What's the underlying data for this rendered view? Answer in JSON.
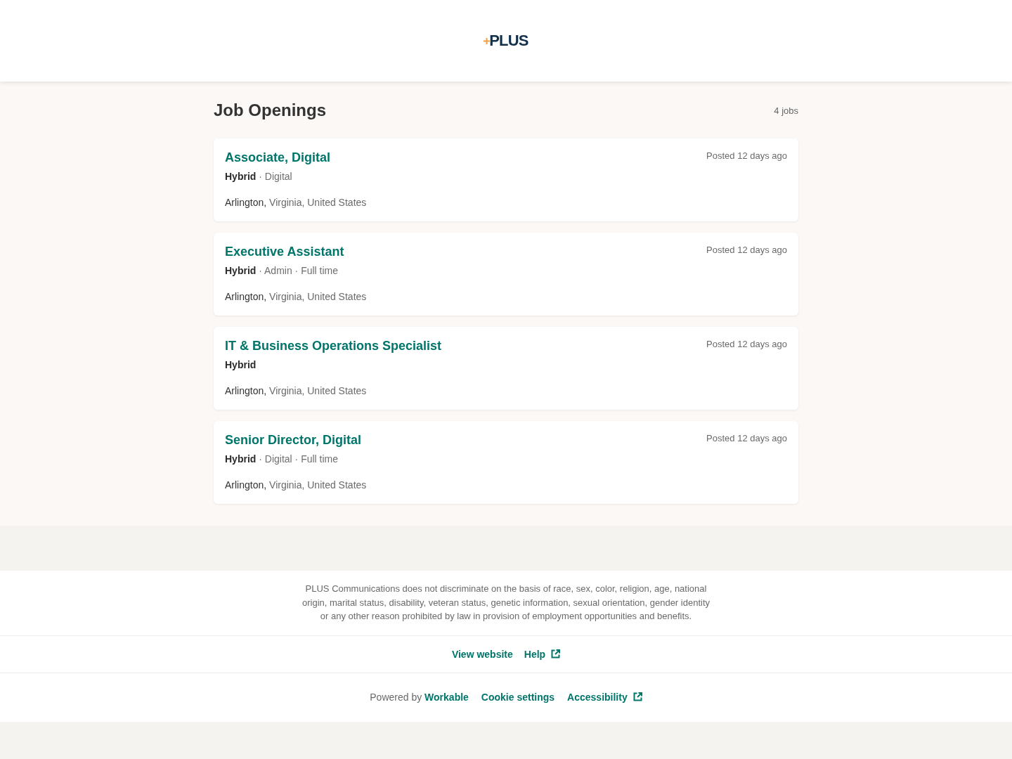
{
  "header": {
    "logo": "PLUS"
  },
  "heading": "Job Openings",
  "job_count": "4 jobs",
  "jobs": [
    {
      "title": "Associate, Digital",
      "details": "**Hybrid** · Digital",
      "city": "Arlington,",
      "region": "Virginia, United States",
      "posted": "Posted 12 days ago"
    },
    {
      "title": "Executive Assistant",
      "details": "**Hybrid** · Admin · Full time",
      "city": "Arlington,",
      "region": "Virginia, United States",
      "posted": "Posted 12 days ago"
    },
    {
      "title": "IT & Business Operations Specialist",
      "details": "**Hybrid**",
      "city": "Arlington,",
      "region": "Virginia, United States",
      "posted": "Posted 12 days ago"
    },
    {
      "title": "Senior Director, Digital",
      "details": "**Hybrid** · Digital · Full time",
      "city": "Arlington,",
      "region": "Virginia, United States",
      "posted": "Posted 12 days ago"
    }
  ],
  "footer": {
    "notice": "PLUS Communications does not discriminate on the basis of race, sex, color, religion, age, national origin, marital status, disability, veteran status, genetic information, sexual orientation, gender identity or any other reason prohibited by law in provision of employment opportunities and benefits.",
    "links": [
      {
        "label": "View website",
        "external": false
      },
      {
        "label": "Help",
        "external": true
      }
    ],
    "powered_by": {
      "text": "Powered by",
      "link": "Workable"
    },
    "bottom_links": [
      {
        "label": "Cookie settings",
        "external": false
      },
      {
        "label": "Accessibility",
        "external": true
      }
    ]
  }
}
